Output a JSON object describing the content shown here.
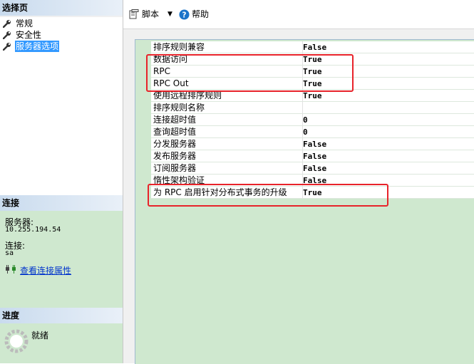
{
  "left": {
    "select_page_title": "选择页",
    "pages": [
      {
        "label": "常规",
        "selected": false
      },
      {
        "label": "安全性",
        "selected": false
      },
      {
        "label": "服务器选项",
        "selected": true
      }
    ],
    "connection_title": "连接",
    "server_label": "服务器:",
    "server_value": "10.255.194.54",
    "connection_label": "连接:",
    "connection_value": "sa",
    "view_properties_link": "查看连接属性",
    "progress_title": "进度",
    "progress_status": "就绪"
  },
  "toolbar": {
    "script_label": "脚本",
    "help_label": "帮助"
  },
  "properties": [
    {
      "name": "排序规则兼容",
      "value": "False"
    },
    {
      "name": "数据访问",
      "value": "True"
    },
    {
      "name": "RPC",
      "value": "True"
    },
    {
      "name": "RPC Out",
      "value": "True"
    },
    {
      "name": "使用远程排序规则",
      "value": "True"
    },
    {
      "name": "排序规则名称",
      "value": ""
    },
    {
      "name": "连接超时值",
      "value": "0"
    },
    {
      "name": "查询超时值",
      "value": "0"
    },
    {
      "name": "分发服务器",
      "value": "False"
    },
    {
      "name": "发布服务器",
      "value": "False"
    },
    {
      "name": "订阅服务器",
      "value": "False"
    },
    {
      "name": "惰性架构验证",
      "value": "False"
    },
    {
      "name": "为 RPC 启用针对分布式事务的升级",
      "value": "True"
    }
  ],
  "colors": {
    "annotation": "#e8232a",
    "panel_green": "#cfe8cf",
    "selection": "#3399ff",
    "link": "#0033cc"
  }
}
